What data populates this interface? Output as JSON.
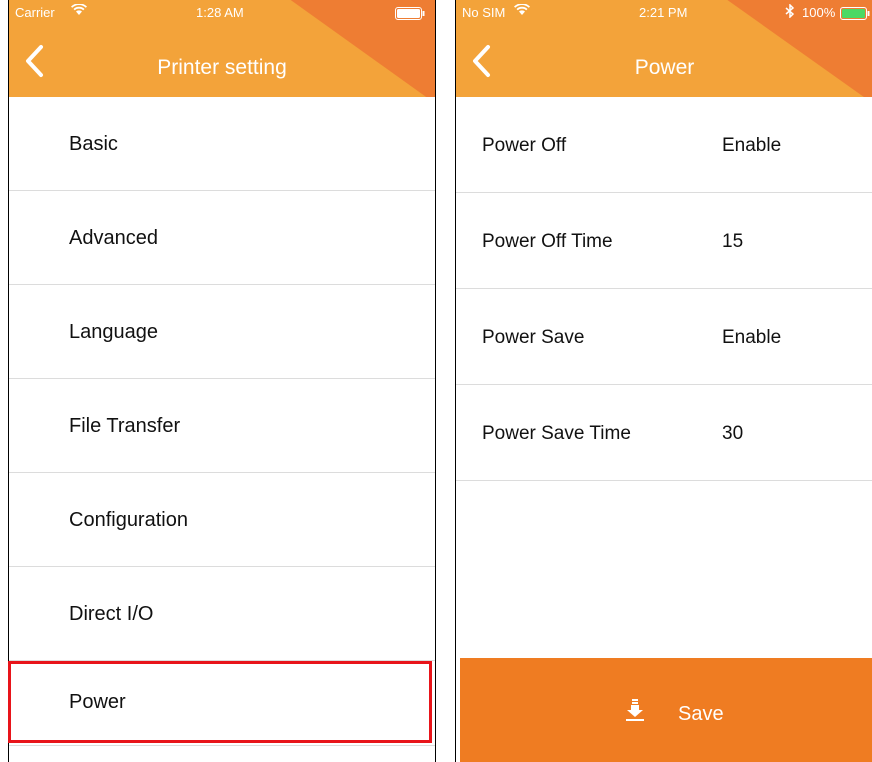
{
  "left": {
    "status": {
      "carrier": "Carrier",
      "time": "1:28 AM"
    },
    "title": "Printer setting",
    "menu": [
      {
        "label": "Basic"
      },
      {
        "label": "Advanced"
      },
      {
        "label": "Language"
      },
      {
        "label": "File Transfer"
      },
      {
        "label": "Configuration"
      },
      {
        "label": "Direct I/O"
      },
      {
        "label": "Power"
      }
    ],
    "highlighted_item": "Power"
  },
  "right": {
    "status": {
      "carrier": "No SIM",
      "time": "2:21 PM",
      "battery": "100%"
    },
    "title": "Power",
    "settings": [
      {
        "label": "Power Off",
        "value": "Enable"
      },
      {
        "label": "Power Off Time",
        "value": "15"
      },
      {
        "label": "Power Save",
        "value": "Enable"
      },
      {
        "label": "Power Save Time",
        "value": "30"
      }
    ],
    "save_label": "Save"
  },
  "colors": {
    "header_primary": "#f3a33a",
    "header_accent": "#ee7d33",
    "save_button": "#ef7c22",
    "highlight_border": "#e8141a",
    "battery_fill": "#4cd964"
  },
  "icons": [
    "wifi-icon",
    "battery-icon",
    "back-chevron-icon",
    "bluetooth-icon",
    "save-download-icon"
  ]
}
